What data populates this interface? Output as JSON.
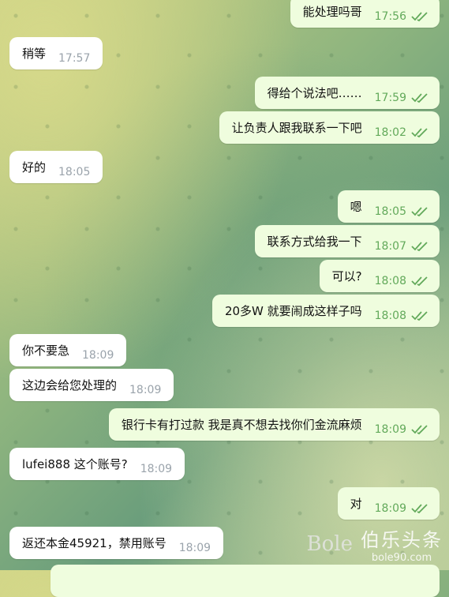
{
  "messages": [
    {
      "dir": "out",
      "text": "能处理吗哥",
      "time": "17:56"
    },
    {
      "dir": "in",
      "text": "稍等",
      "time": "17:57"
    },
    {
      "dir": "out",
      "text": "得给个说法吧……",
      "time": "17:59"
    },
    {
      "dir": "out",
      "text": "让负责人跟我联系一下吧",
      "time": "18:02"
    },
    {
      "dir": "in",
      "text": "好的",
      "time": "18:05"
    },
    {
      "dir": "out",
      "text": "嗯",
      "time": "18:05"
    },
    {
      "dir": "out",
      "text": "联系方式给我一下",
      "time": "18:07"
    },
    {
      "dir": "out",
      "text": "可以?",
      "time": "18:08"
    },
    {
      "dir": "out",
      "text": "20多W 就要闹成这样子吗",
      "time": "18:08"
    },
    {
      "dir": "in",
      "text": "你不要急",
      "time": "18:09"
    },
    {
      "dir": "in",
      "text": "这边会给您处理的",
      "time": "18:09"
    },
    {
      "dir": "out",
      "text": "银行卡有打过款 我是真不想去找你们金流麻烦",
      "time": "18:09"
    },
    {
      "dir": "in",
      "text": "lufei888 这个账号?",
      "time": "18:09"
    },
    {
      "dir": "out",
      "text": "对",
      "time": "18:09"
    },
    {
      "dir": "in",
      "text": "返还本金45921，禁用账号",
      "time": "18:09"
    }
  ],
  "watermark": {
    "logo": "Bole",
    "cn": "伯乐头条",
    "url": "bole90.com"
  },
  "colors": {
    "outgoing_bg": "#effdde",
    "incoming_bg": "#ffffff",
    "check": "#62a95a"
  },
  "icons": {
    "read_receipt": "double-check-icon"
  }
}
